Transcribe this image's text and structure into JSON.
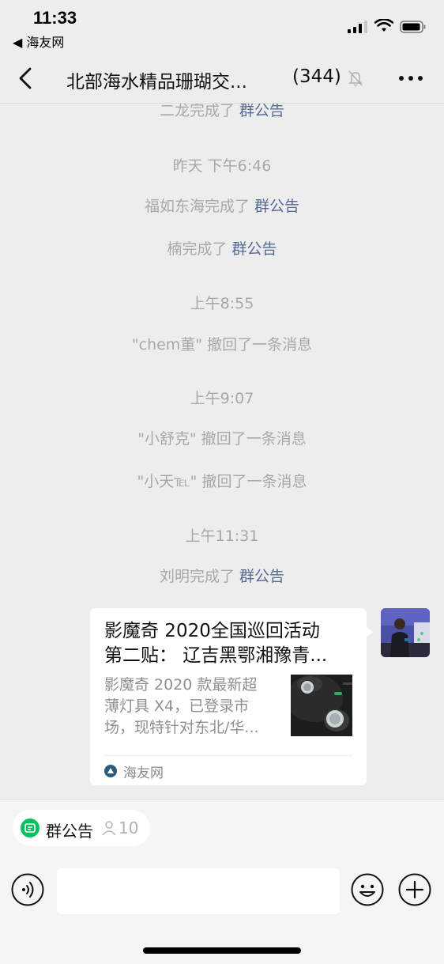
{
  "status_bar": {
    "time": "11:33",
    "back_app": "◀ 海友网"
  },
  "nav": {
    "title": "北部海水精品珊瑚交...",
    "member_count": "(344)",
    "back_icon": "chevron-left-icon",
    "mute_icon": "bell-muted-icon",
    "more_icon": "ellipsis-icon"
  },
  "messages": {
    "m0": {
      "prefix": "二龙完成了 ",
      "link": "群公告"
    },
    "ts1": "昨天 下午6:46",
    "m1": {
      "prefix": "福如东海完成了 ",
      "link": "群公告"
    },
    "m2": {
      "prefix": "楠完成了 ",
      "link": "群公告"
    },
    "ts2": "上午8:55",
    "m3": "\"chem董\" 撤回了一条消息",
    "ts3": "上午9:07",
    "m4": "\"小舒克\" 撤回了一条消息",
    "m5": "\"小天℡\" 撤回了一条消息",
    "ts4": "上午11:31",
    "m6": {
      "prefix": "刘明完成了 ",
      "link": "群公告"
    }
  },
  "card": {
    "title_line1": "影魔奇 2020全国巡回活动",
    "title_line2": "第二贴： 辽吉黑鄂湘豫青...",
    "desc_line1": "影魔奇 2020 款最新超",
    "desc_line2": "薄灯具 X4，已登录市",
    "desc_line3": "场，现特针对东北/华...",
    "source": "海友网"
  },
  "bottom": {
    "announcement_label": "群公告",
    "announcement_count": "10",
    "input_placeholder": "",
    "voice_icon": "voice-icon",
    "emoji_icon": "emoji-icon",
    "plus_icon": "plus-icon"
  },
  "colors": {
    "background": "#ededed",
    "link": "#576b95",
    "system_text": "#a8a8a8",
    "wechat_green": "#07c160"
  }
}
